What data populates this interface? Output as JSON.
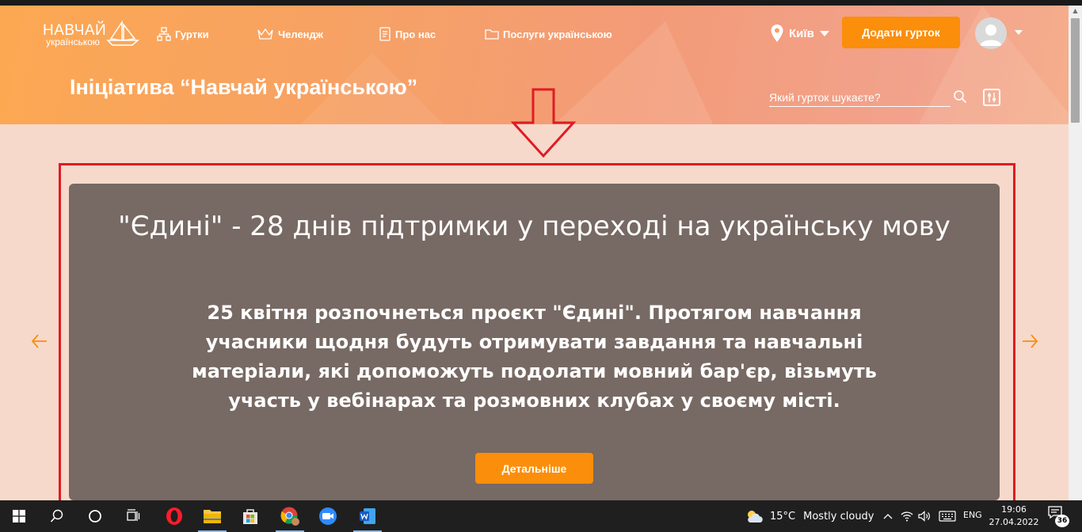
{
  "header": {
    "logo_top": "НАВЧАЙ",
    "logo_bottom": "українською",
    "nav": [
      {
        "label": "Гуртки",
        "icon": "hierarchy-icon"
      },
      {
        "label": "Челендж",
        "icon": "crown-icon"
      },
      {
        "label": "Про нас",
        "icon": "document-icon"
      },
      {
        "label": "Послуги українською",
        "icon": "folder-icon"
      }
    ],
    "city": "Київ",
    "add_button": "Додати гурток",
    "page_title": "Ініціатива “Навчай українською”",
    "search_placeholder": "Який гурток шукаєте?"
  },
  "slide": {
    "title": "\"Єдині\" - 28 днів підтримки у переході на українську мову",
    "text": "25 квітня розпочнеться проєкт \"Єдині\". Протягом навчання учасники щодня будуть отримувати завдання та навчальні матеріали, які допоможуть подолати мовний бар'єр, візьмуть участь у вебінарах та розмовних клубах у своєму місті.",
    "button": "Детальніше"
  },
  "colors": {
    "accent": "#fb8e0a",
    "highlight": "#e01b24",
    "slide_bg": "#776963"
  },
  "taskbar": {
    "temperature": "15°C",
    "weather": "Mostly cloudy",
    "language": "ENG",
    "time": "19:06",
    "date": "27.04.2022",
    "notifications": "36"
  }
}
